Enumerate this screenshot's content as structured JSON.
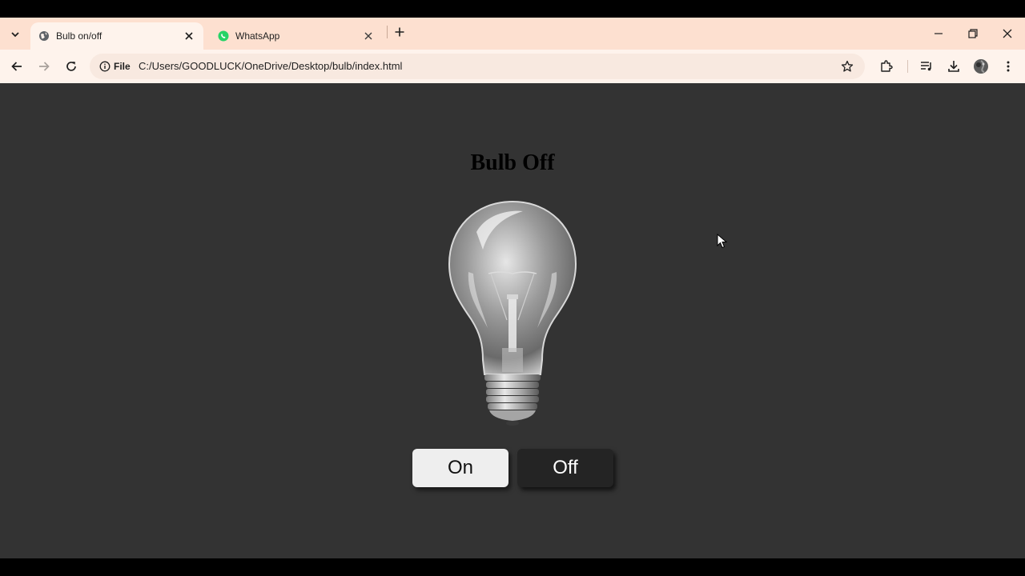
{
  "browser": {
    "tabs": [
      {
        "title": "Bulb on/off",
        "active": true,
        "favicon": "globe-icon"
      },
      {
        "title": "WhatsApp",
        "active": false,
        "favicon": "whatsapp-icon"
      }
    ],
    "address": {
      "chip_label": "File",
      "url": "C:/Users/GOODLUCK/OneDrive/Desktop/bulb/index.html"
    },
    "colors": {
      "tabstrip": "#fde0d0",
      "toolbar": "#fef3ec"
    }
  },
  "page": {
    "heading": "Bulb Off",
    "bulb_state": "off",
    "buttons": {
      "on_label": "On",
      "off_label": "Off"
    },
    "background": "#333333"
  }
}
